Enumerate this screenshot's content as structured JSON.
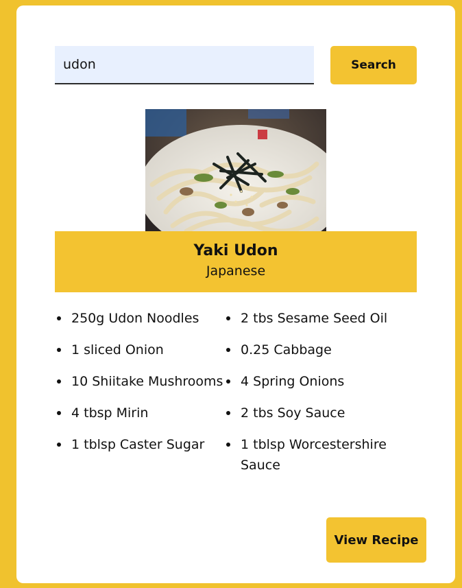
{
  "search": {
    "value": "udon",
    "button_label": "Search"
  },
  "recipe": {
    "image": "yaki-udon-photo",
    "title": "Yaki Udon",
    "cuisine": "Japanese",
    "ingredients": [
      "250g Udon Noodles",
      "2 tbs Sesame Seed Oil",
      "1 sliced Onion",
      "0.25 Cabbage",
      "10 Shiitake Mushrooms",
      "4 Spring Onions",
      "4 tbsp Mirin",
      "2 tbs Soy Sauce",
      "1 tblsp Caster Sugar",
      "1 tblsp Worcestershire Sauce"
    ],
    "view_label": "View Recipe"
  },
  "colors": {
    "background": "#f0c22e",
    "accent": "#f3c331",
    "card": "#ffffff",
    "input": "#e8f0fe"
  }
}
